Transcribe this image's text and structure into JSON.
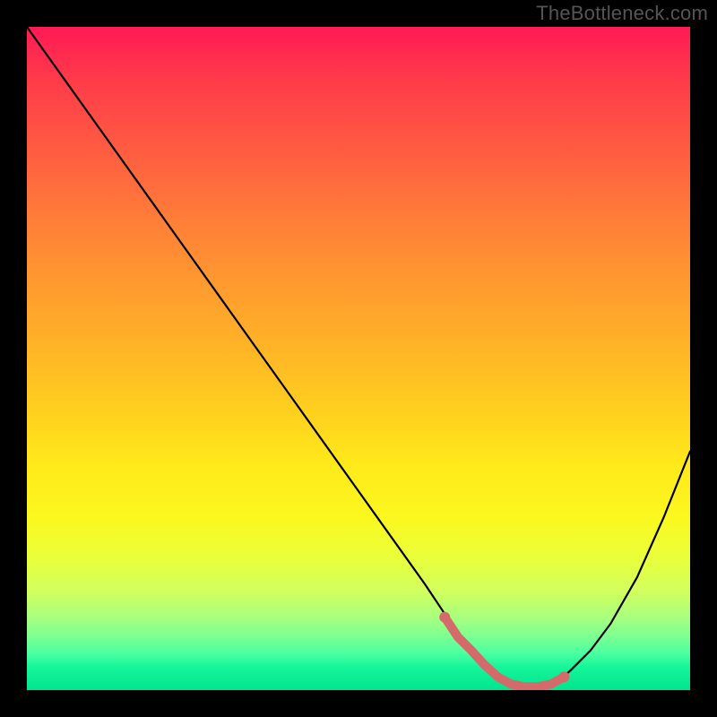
{
  "watermark": "TheBottleneck.com",
  "colors": {
    "curve": "#000000",
    "highlight_stroke": "#d46a6a",
    "highlight_dot": "#d46a6a",
    "background_border": "#000000"
  },
  "chart_data": {
    "type": "line",
    "title": "",
    "xlabel": "",
    "ylabel": "",
    "xlim": [
      0,
      100
    ],
    "ylim": [
      0,
      100
    ],
    "series": [
      {
        "name": "bottleneck-curve",
        "x": [
          0,
          5,
          10,
          15,
          20,
          25,
          30,
          35,
          40,
          45,
          50,
          55,
          60,
          62,
          64,
          66,
          68,
          70,
          72,
          74,
          76,
          78,
          80,
          82,
          85,
          88,
          92,
          96,
          100
        ],
        "values": [
          100,
          93,
          86,
          79,
          72,
          65,
          58,
          51,
          44,
          37,
          30,
          23,
          16,
          13,
          10,
          7,
          5,
          3,
          1.5,
          0.8,
          0.5,
          0.6,
          1.2,
          3,
          6,
          10,
          17,
          26,
          36
        ]
      }
    ],
    "highlight_segment": {
      "name": "optimal-range",
      "x": [
        63,
        65,
        67,
        69,
        71,
        73,
        75,
        77,
        79,
        81
      ],
      "values": [
        11,
        8,
        6,
        3.8,
        2,
        0.9,
        0.5,
        0.5,
        0.9,
        2
      ]
    }
  }
}
